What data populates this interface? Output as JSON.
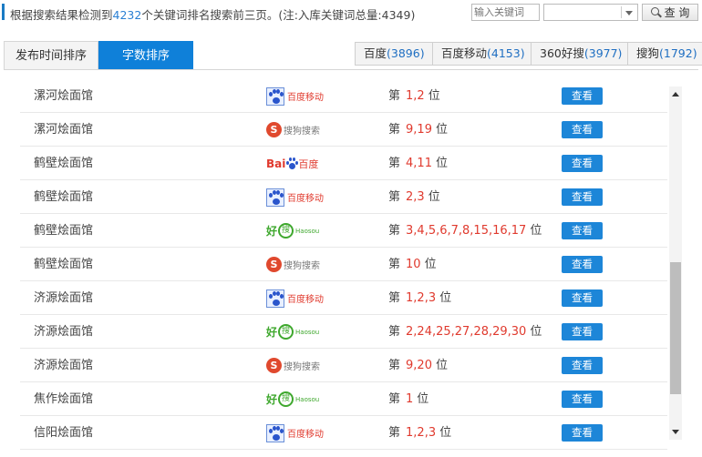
{
  "header": {
    "summary_prefix": "根据搜索结果检测到",
    "count": "4232",
    "summary_suffix": "个关键词排名搜索前三页。(注:入库关键词总量:4349)",
    "keyword_placeholder": "输入关键词",
    "select_value": "",
    "query_label": "查 询"
  },
  "sort_tabs": [
    {
      "label": "发布时间排序",
      "active": false
    },
    {
      "label": "字数排序",
      "active": true
    }
  ],
  "engines": [
    {
      "name": "百度",
      "count": "(3896)"
    },
    {
      "name": "百度移动",
      "count": "(4153)"
    },
    {
      "name": "360好搜",
      "count": "(3977)"
    },
    {
      "name": "搜狗",
      "count": "(1792)"
    }
  ],
  "logos": {
    "baidu_mobile": "百度移动",
    "sogou": "搜狗搜索",
    "baidu_bai": "Bai",
    "baidu_du": "百度",
    "haosou_hao": "好",
    "haosou_sou": "搜",
    "haosou_sub": "Haosou"
  },
  "rank_prefix": "第",
  "rank_suffix": "位",
  "view_label": "查看",
  "rows": [
    {
      "keyword": "漯河烩面馆",
      "engine": "baidu_mobile",
      "positions": "1,2"
    },
    {
      "keyword": "漯河烩面馆",
      "engine": "sogou",
      "positions": "9,19"
    },
    {
      "keyword": "鹤壁烩面馆",
      "engine": "baidu",
      "positions": "4,11"
    },
    {
      "keyword": "鹤壁烩面馆",
      "engine": "baidu_mobile",
      "positions": "2,3"
    },
    {
      "keyword": "鹤壁烩面馆",
      "engine": "haosou",
      "positions": "3,4,5,6,7,8,15,16,17"
    },
    {
      "keyword": "鹤壁烩面馆",
      "engine": "sogou",
      "positions": "10"
    },
    {
      "keyword": "济源烩面馆",
      "engine": "baidu_mobile",
      "positions": "1,2,3"
    },
    {
      "keyword": "济源烩面馆",
      "engine": "haosou",
      "positions": "2,24,25,27,28,29,30"
    },
    {
      "keyword": "济源烩面馆",
      "engine": "sogou",
      "positions": "9,20"
    },
    {
      "keyword": "焦作烩面馆",
      "engine": "haosou",
      "positions": "1"
    },
    {
      "keyword": "信阳烩面馆",
      "engine": "baidu_mobile",
      "positions": "1,2,3"
    }
  ],
  "colors": {
    "accent": "#0f80d9",
    "count_blue": "#2a7fd3",
    "rank_red": "#e03a2e",
    "view_button": "#1d86d8"
  }
}
